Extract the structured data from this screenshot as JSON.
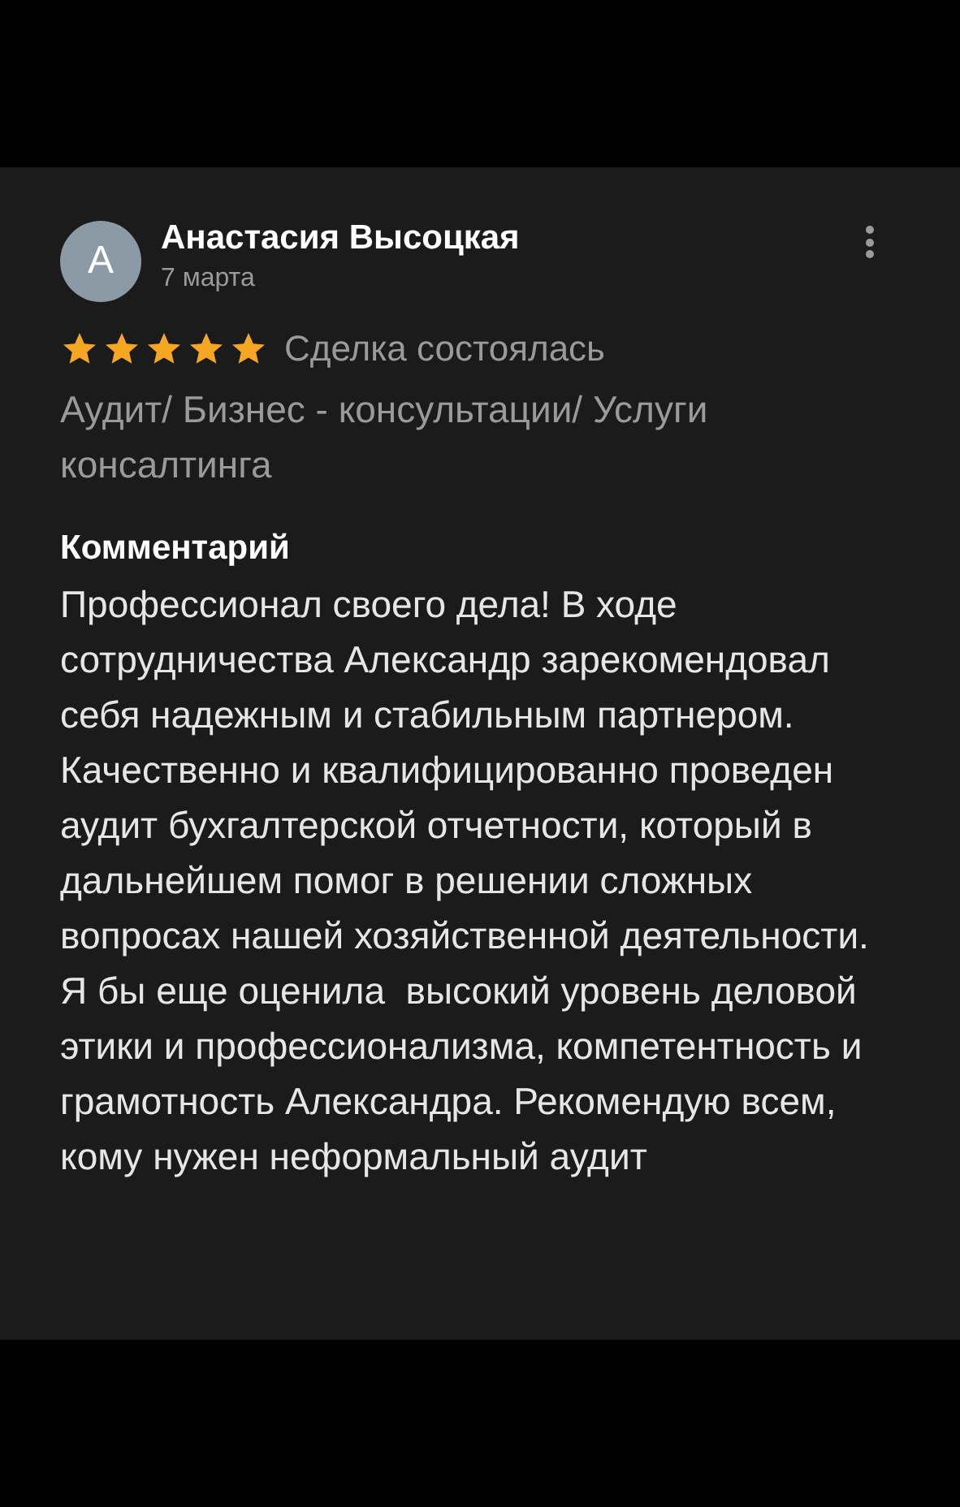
{
  "review": {
    "avatar_letter": "А",
    "author": "Анастасия Высоцкая",
    "date": "7 марта",
    "stars": 5,
    "status": "Сделка состоялась",
    "category": "Аудит/ Бизнес - консультации/ Услуги консалтинга",
    "comment_heading": "Комментарий",
    "comment_paragraphs": [
      "Профессионал своего дела! В ходе сотрудничества Александр зарекомендовал себя надежным и стабильным партнером. Качественно и квалифицированно проведен аудит бухгалтерской отчетности, который в дальнейшем помог в решении сложных вопросах нашей хозяйственной деятельности.",
      "Я бы еще оценила  высокий уровень деловой этики и профессионализма, компетентность и грамотность Александра. Рекомендую всем, кому нужен неформальный аудит"
    ]
  }
}
